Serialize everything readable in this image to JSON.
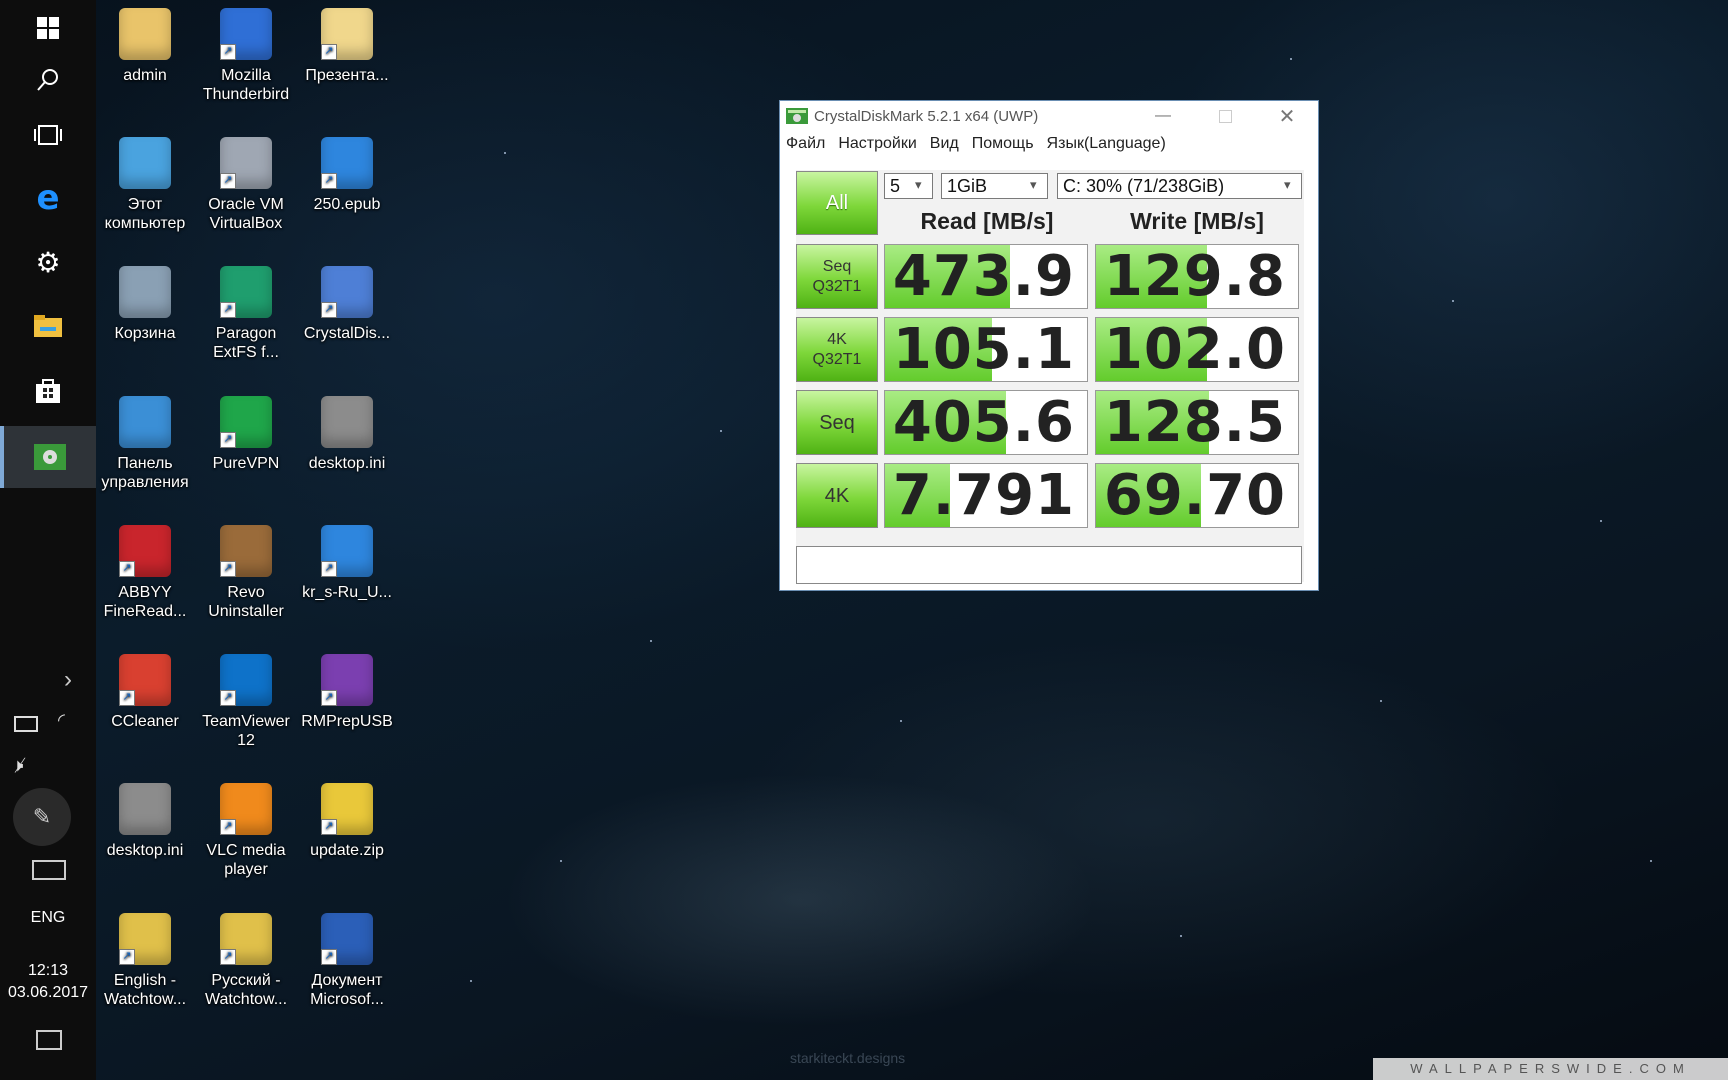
{
  "taskbar": {
    "language": "ENG",
    "time": "12:13",
    "date": "03.06.2017",
    "icons": [
      "start-icon",
      "search-icon",
      "task-view-icon",
      "edge-icon",
      "settings-icon",
      "file-explorer-icon",
      "store-icon",
      "crystaldiskmark-taskbar-icon"
    ]
  },
  "desktop": {
    "icons": [
      {
        "label": "admin",
        "name": "admin-folder"
      },
      {
        "label": "Mozilla Thunderbird",
        "name": "thunderbird"
      },
      {
        "label": "Презента...",
        "name": "presentation"
      },
      {
        "label": "Этот компьютер",
        "name": "this-pc"
      },
      {
        "label": "Oracle VM VirtualBox",
        "name": "virtualbox"
      },
      {
        "label": "250.epub",
        "name": "epub-250"
      },
      {
        "label": "Корзина",
        "name": "recycle-bin"
      },
      {
        "label": "Paragon ExtFS f...",
        "name": "paragon-extfs"
      },
      {
        "label": "CrystalDis...",
        "name": "crystaldisk"
      },
      {
        "label": "Панель управления",
        "name": "control-panel"
      },
      {
        "label": "PureVPN",
        "name": "purevpn"
      },
      {
        "label": "desktop.ini",
        "name": "desktop-ini-1"
      },
      {
        "label": "ABBYY FineRead...",
        "name": "abbyy"
      },
      {
        "label": "Revo Uninstaller",
        "name": "revo"
      },
      {
        "label": "kr_s-Ru_U...",
        "name": "kr-epub"
      },
      {
        "label": "CCleaner",
        "name": "ccleaner"
      },
      {
        "label": "TeamViewer 12",
        "name": "teamviewer"
      },
      {
        "label": "RMPrepUSB",
        "name": "rmprepusb"
      },
      {
        "label": "desktop.ini",
        "name": "desktop-ini-2"
      },
      {
        "label": "VLC media player",
        "name": "vlc"
      },
      {
        "label": "update.zip",
        "name": "update-zip"
      },
      {
        "label": "English - Watchtow...",
        "name": "watchtower-en"
      },
      {
        "label": "Русский - Watchtow...",
        "name": "watchtower-ru"
      },
      {
        "label": "Документ Microsof...",
        "name": "word-doc"
      }
    ]
  },
  "cdm": {
    "title": "CrystalDiskMark 5.2.1 x64 (UWP)",
    "menu": [
      "Файл",
      "Настройки",
      "Вид",
      "Помощь",
      "Язык(Language)"
    ],
    "all_label": "All",
    "count": "5",
    "size": "1GiB",
    "drive": "C: 30% (71/238GiB)",
    "read_header": "Read [MB/s]",
    "write_header": "Write [MB/s]",
    "rows": [
      {
        "l1": "Seq",
        "l2": "Q32T1",
        "read": "473.9",
        "write": "129.8",
        "read_fill": 0.62,
        "write_fill": 0.55
      },
      {
        "l1": "4K",
        "l2": "Q32T1",
        "read": "105.1",
        "write": "102.0",
        "read_fill": 0.53,
        "write_fill": 0.55
      },
      {
        "l1": "Seq",
        "l2": "",
        "read": "405.6",
        "write": "128.5",
        "read_fill": 0.6,
        "write_fill": 0.56
      },
      {
        "l1": "4K",
        "l2": "",
        "read": "7.791",
        "write": "69.70",
        "read_fill": 0.32,
        "write_fill": 0.52
      }
    ]
  },
  "watermark": "WALLPAPERSWIDE.COM",
  "credit": "starkiteckt.designs"
}
